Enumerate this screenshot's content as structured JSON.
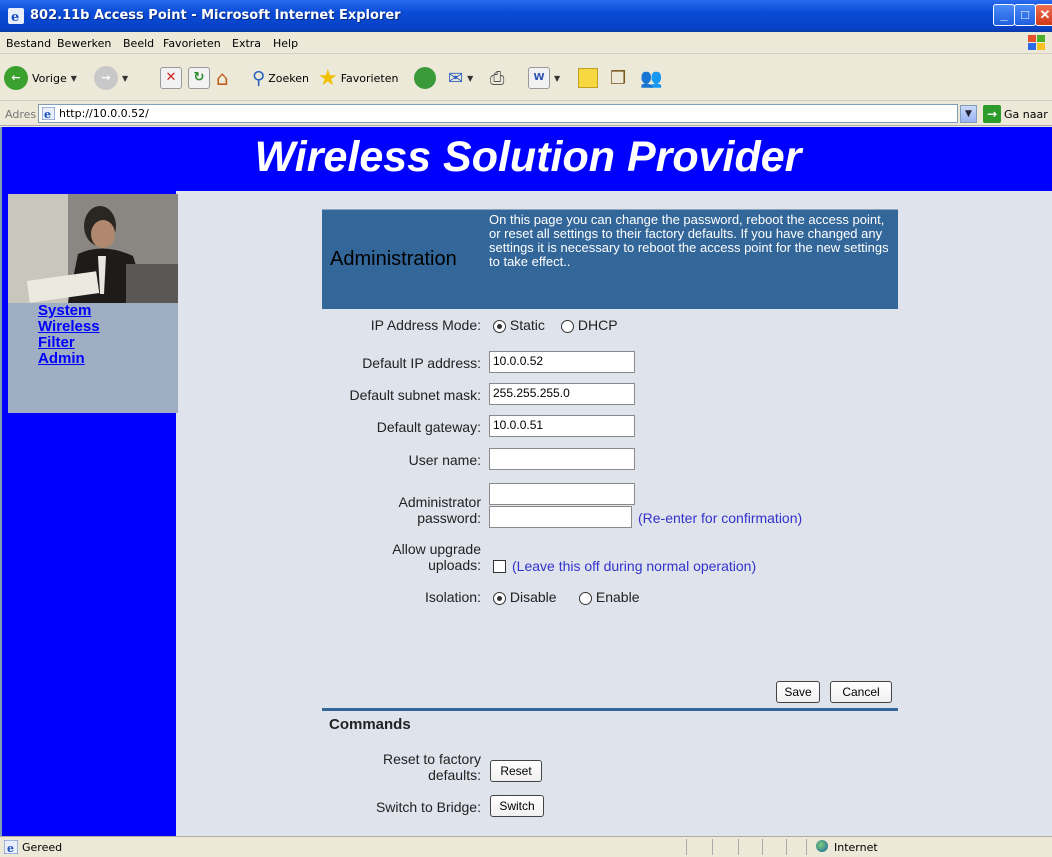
{
  "window": {
    "title": "802.11b Access Point - Microsoft Internet Explorer"
  },
  "menu": [
    "Bestand",
    "Bewerken",
    "Beeld",
    "Favorieten",
    "Extra",
    "Help"
  ],
  "toolbar": {
    "back_label": "Vorige",
    "search_label": "Zoeken",
    "favorites_label": "Favorieten"
  },
  "address": {
    "label": "Adres",
    "url": "http://10.0.0.52/",
    "go_label": "Ga naar"
  },
  "banner": {
    "title": "Wireless Solution Provider"
  },
  "sidebar": {
    "links": [
      "System",
      "Wireless",
      "Filter",
      "Admin"
    ]
  },
  "admin": {
    "heading": "Administration",
    "description": "On this page you can change the password, reboot the access point, or reset all settings to their factory defaults. If you have changed any settings it is necessary to reboot the access point for the new settings to take effect.."
  },
  "form": {
    "ip_mode_label": "IP Address Mode:",
    "ip_mode_options": [
      "Static",
      "DHCP"
    ],
    "ip_mode_selected": "Static",
    "ip_label": "Default IP address:",
    "ip_value": "10.0.0.52",
    "subnet_label": "Default subnet mask:",
    "subnet_value": "255.255.255.0",
    "gateway_label": "Default gateway:",
    "gateway_value": "10.0.0.51",
    "username_label": "User name:",
    "username_value": "",
    "password_label_1": "Administrator",
    "password_label_2": "password:",
    "password_value": "",
    "password_confirm_value": "",
    "reenter_hint": "(Re-enter for confirmation)",
    "upgrade_label_1": "Allow upgrade",
    "upgrade_label_2": "uploads:",
    "upgrade_hint": "(Leave this off during normal operation)",
    "upgrade_checked": false,
    "isolation_label": "Isolation:",
    "isolation_options": [
      "Disable",
      "Enable"
    ],
    "isolation_selected": "Disable",
    "save_label": "Save",
    "cancel_label": "Cancel"
  },
  "commands": {
    "heading": "Commands",
    "reset_label_1": "Reset to factory",
    "reset_label_2": "defaults:",
    "reset_button": "Reset",
    "switch_label": "Switch to Bridge:",
    "switch_button": "Switch"
  },
  "status": {
    "left": "Gereed",
    "zone": "Internet"
  }
}
